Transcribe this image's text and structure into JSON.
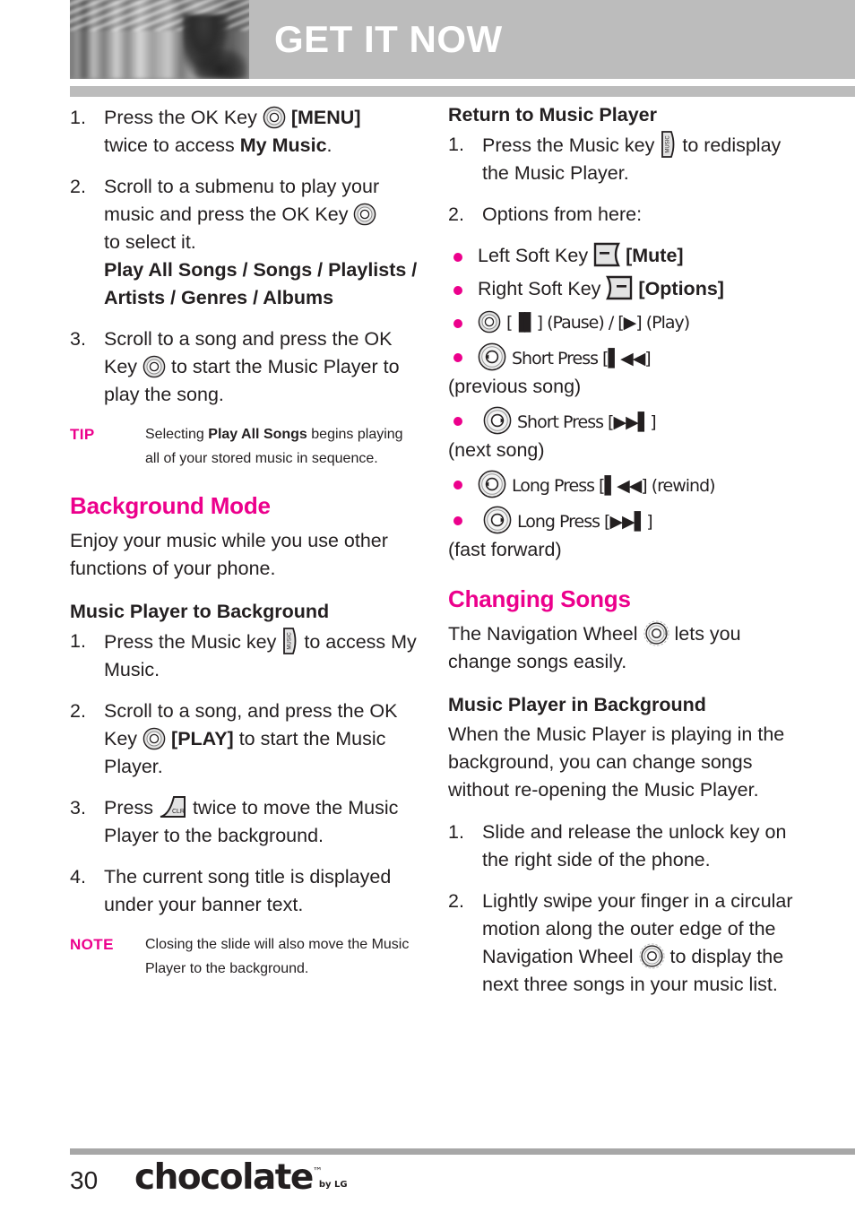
{
  "header": {
    "title": "GET IT NOW",
    "photo_alt": "blurred-grayscale-photo"
  },
  "colors": {
    "accent": "#ec008c",
    "header_bg": "#bcbcbc",
    "text": "#231f20"
  },
  "left_column": {
    "steps": [
      {
        "num": "1.",
        "a": "Press the OK Key",
        "icon": "ok-key",
        "b": "[MENU]",
        "c": "twice to access",
        "d": "My Music",
        "e": "."
      },
      {
        "num": "2.",
        "a": "Scroll to a submenu to play your music and press the OK Key",
        "icon": "ok-key",
        "b": "to select it.",
        "c": "Play All Songs / Songs / Playlists / Artists / Genres / Albums"
      },
      {
        "num": "3.",
        "a": "Scroll to a song and press the OK Key",
        "icon": "ok-key",
        "b": "to start the Music Player to play the song."
      }
    ],
    "tip": {
      "tag": "TIP",
      "a": "Selecting",
      "b": "Play All Songs",
      "c": "begins playing all of your stored music in sequence."
    },
    "background_mode": {
      "heading": "Background Mode",
      "body": "Enjoy your music while you use other functions of your phone.",
      "sub_heading": "Music Player to Background",
      "steps": [
        {
          "num": "1.",
          "a": "Press the Music key",
          "icon": "music-key",
          "b": "to access My Music."
        },
        {
          "num": "2.",
          "a": "Scroll to a song, and press the OK Key",
          "icon": "ok-key",
          "b": "[PLAY]",
          "c": "to start the Music Player."
        },
        {
          "num": "3.",
          "a": "Press",
          "icon": "clr-key",
          "b": "twice to move the Music Player to the background."
        },
        {
          "num": "4.",
          "a": "The current song title is displayed under your banner text."
        }
      ],
      "note": {
        "tag": "NOTE",
        "text": "Closing the slide will also move the Music Player to the background."
      }
    }
  },
  "right_column": {
    "return_to_player": {
      "heading": "Return to Music Player",
      "steps": [
        {
          "num": "1.",
          "a": "Press the Music key",
          "icon": "music-key",
          "b": "to redisplay the Music Player."
        },
        {
          "num": "2.",
          "a": "Options from here:"
        }
      ],
      "bullets": [
        {
          "icon": "left-soft-key",
          "a": "Left Soft Key",
          "b": "[Mute]"
        },
        {
          "icon": "right-soft-key",
          "a": "Right Soft Key",
          "b": "[Options]"
        },
        {
          "icon": "ok-key",
          "a": "[▐▌] (Pause) / [▶] (Play)"
        },
        {
          "icon": "wheel-left",
          "a": "Short Press [▌◀◀]",
          "b": "(previous song)"
        },
        {
          "icon": "wheel-right",
          "a": "Short Press [▶▶▌]",
          "b": "(next song)"
        },
        {
          "icon": "wheel-left",
          "a": "Long Press [▌◀◀] (rewind)"
        },
        {
          "icon": "wheel-right",
          "a": "Long Press [▶▶▌]",
          "b": "(fast forward)"
        }
      ]
    },
    "changing_songs": {
      "heading": "Changing Songs",
      "body_a": "The Navigation Wheel",
      "body_b": "lets you change songs easily.",
      "sub_heading": "Music Player in Background",
      "sub_body": "When the Music Player is playing in the background, you can change songs without re-opening the Music Player.",
      "steps": [
        {
          "num": "1.",
          "a": "Slide and release the unlock key on the right side of the phone."
        },
        {
          "num": "2.",
          "a": "Lightly swipe your finger in a circular motion along the outer edge of the Navigation Wheel",
          "icon": "wheel-swipe",
          "b": "to display the next three songs in your music list."
        }
      ]
    }
  },
  "footer": {
    "page_number": "30",
    "logo": "chocolate",
    "logo_tm": "™",
    "logo_by": "by LG"
  }
}
